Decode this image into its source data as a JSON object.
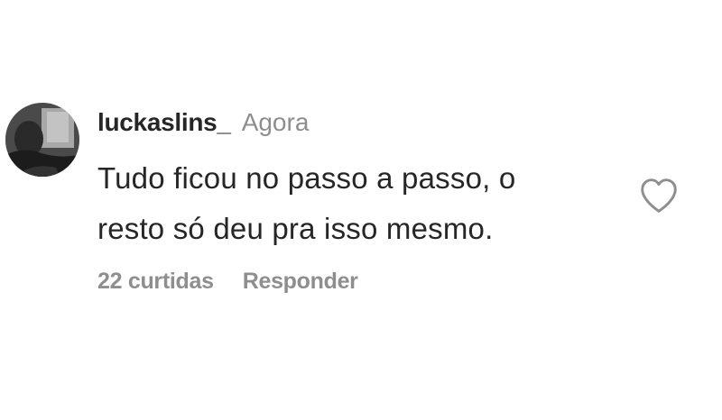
{
  "comment": {
    "username": "luckaslins_",
    "timestamp": "Agora",
    "text_lines": [
      "Tudo ficou no passo a passo, o",
      "resto só deu pra isso mesmo."
    ],
    "likes": "22 curtidas",
    "reply_label": "Responder",
    "like_icon": "heart-outline-icon"
  },
  "colors": {
    "text": "#262626",
    "muted": "#8e8e8e",
    "background": "#ffffff"
  }
}
